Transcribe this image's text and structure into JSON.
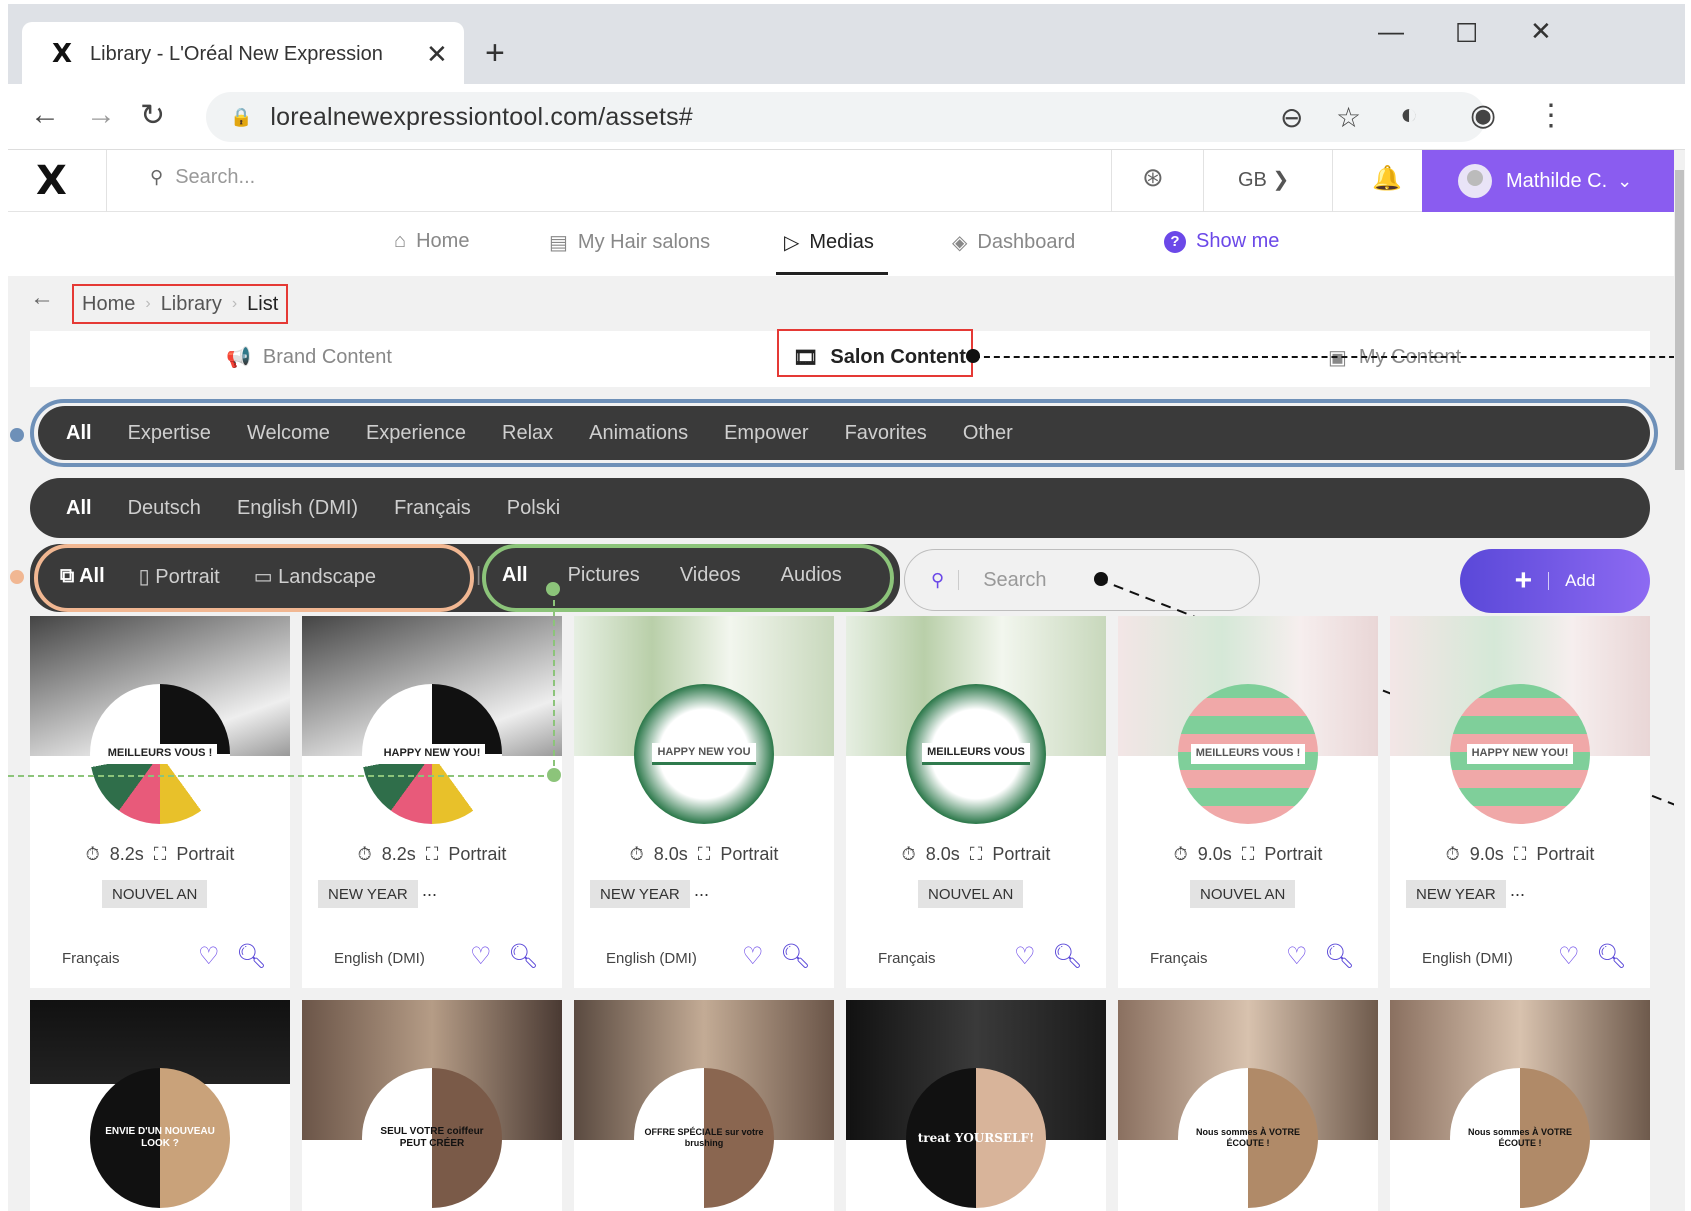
{
  "browser": {
    "tab_title": "Library - L'Oréal New Expression",
    "tab_close": "✕",
    "new_tab": "+",
    "url": "lorealnewexpressiontool.com/assets#"
  },
  "header": {
    "logo": "X",
    "search_placeholder": "Search...",
    "country": "GB ❯",
    "user_name": "Mathilde C."
  },
  "nav": {
    "items": [
      {
        "label": "Home",
        "icon": "home-icon"
      },
      {
        "label": "My Hair salons",
        "icon": "salon-icon"
      },
      {
        "label": "Medias",
        "icon": "play-icon",
        "active": true
      },
      {
        "label": "Dashboard",
        "icon": "layers-icon"
      },
      {
        "label": "Show me",
        "icon": "help-icon"
      }
    ]
  },
  "breadcrumb": [
    "Home",
    "Library",
    "List"
  ],
  "content_tabs": [
    "Brand Content",
    "Salon Content",
    "My Content"
  ],
  "themes": [
    "All",
    "Expertise",
    "Welcome",
    "Experience",
    "Relax",
    "Animations",
    "Empower",
    "Favorites",
    "Other"
  ],
  "languages": [
    "All",
    "Deutsch",
    "English (DMI)",
    "Français",
    "Polski"
  ],
  "orientation": [
    "All",
    "Portrait",
    "Landscape"
  ],
  "media_types": [
    "All",
    "Pictures",
    "Videos",
    "Audios"
  ],
  "filter_search_placeholder": "Search",
  "add_label": "Add",
  "cards_row1": [
    {
      "duration": "8.2s",
      "format": "Portrait",
      "tag": "NOUVEL AN",
      "more": "",
      "language": "Français",
      "overlay": "MEILLEURS VOUS !"
    },
    {
      "duration": "8.2s",
      "format": "Portrait",
      "tag": "NEW YEAR",
      "more": "...",
      "language": "English (DMI)",
      "overlay": "HAPPY NEW YOU!"
    },
    {
      "duration": "8.0s",
      "format": "Portrait",
      "tag": "NEW YEAR",
      "more": "...",
      "language": "English (DMI)",
      "overlay": "HAPPY NEW YOU"
    },
    {
      "duration": "8.0s",
      "format": "Portrait",
      "tag": "NOUVEL AN",
      "more": "",
      "language": "Français",
      "overlay": "MEILLEURS VOUS"
    },
    {
      "duration": "9.0s",
      "format": "Portrait",
      "tag": "NOUVEL AN",
      "more": "",
      "language": "Français",
      "overlay": "MEILLEURS VOUS !"
    },
    {
      "duration": "9.0s",
      "format": "Portrait",
      "tag": "NEW YEAR",
      "more": "...",
      "language": "English (DMI)",
      "overlay": "HAPPY NEW YOU!"
    }
  ],
  "cards_row2": [
    {
      "overlay": "ENVIE D'UN NOUVEAU LOOK ?"
    },
    {
      "overlay": "SEUL VOTRE coiffeur PEUT CRÉER"
    },
    {
      "overlay": "OFFRE SPÉCIALE sur votre brushing"
    },
    {
      "overlay": "treat YOURSELF!"
    },
    {
      "overlay": "Nous sommes À VOTRE ÉCOUTE !"
    },
    {
      "overlay": "Nous sommes À VOTRE ÉCOUTE !"
    }
  ],
  "colors": {
    "accent": "#6b48e8",
    "user_bar": "#8a5cf0",
    "pill_bar": "#3a3a3a",
    "ring_theme": "#6e90b8",
    "ring_orientation": "#f1b792",
    "ring_media": "#8cc47a",
    "highlight": "#e53935"
  }
}
